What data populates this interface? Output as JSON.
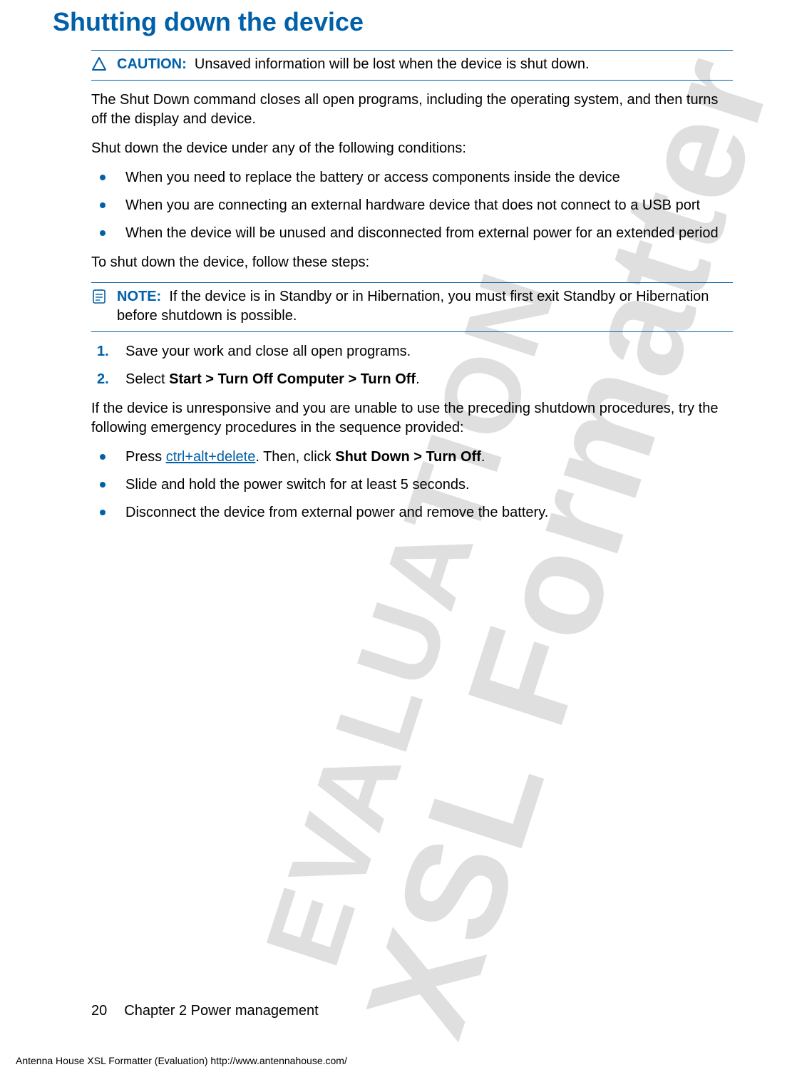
{
  "watermark": {
    "line1": "XSL Formatter",
    "line2": "EVALUATION"
  },
  "heading": "Shutting down the device",
  "caution": {
    "label": "CAUTION:",
    "text": "Unsaved information will be lost when the device is shut down."
  },
  "para1": "The Shut Down command closes all open programs, including the operating system, and then turns off the display and device.",
  "para2": "Shut down the device under any of the following conditions:",
  "bullets1": [
    "When you need to replace the battery or access components inside the device",
    "When you are connecting an external hardware device that does not connect to a USB port",
    "When the device will be unused and disconnected from external power for an extended period"
  ],
  "para3": "To shut down the device, follow these steps:",
  "note": {
    "label": "NOTE:",
    "text": "If the device is in Standby or in Hibernation, you must first exit Standby or Hibernation before shutdown is possible."
  },
  "steps": {
    "s1": "Save your work and close all open programs.",
    "s2_pre": "Select ",
    "s2_bold": "Start > Turn Off Computer > Turn Off",
    "s2_post": "."
  },
  "para4": "If the device is unresponsive and you are unable to use the preceding shutdown procedures, try the following emergency procedures in the sequence provided:",
  "bullets2": {
    "b1_pre": "Press ",
    "b1_link": "ctrl+alt+delete",
    "b1_mid": ". Then, click ",
    "b1_bold": "Shut Down > Turn Off",
    "b1_post": ".",
    "b2": "Slide and hold the power switch for at least 5 seconds.",
    "b3": "Disconnect the device from external power and remove the battery."
  },
  "footer": {
    "page": "20",
    "chapter": "Chapter 2   Power management"
  },
  "imprint": "Antenna House XSL Formatter (Evaluation)  http://www.antennahouse.com/"
}
